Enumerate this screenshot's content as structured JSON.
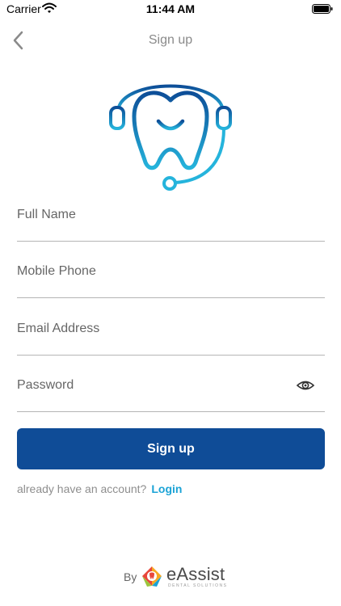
{
  "status_bar": {
    "carrier": "Carrier",
    "time": "11:44 AM"
  },
  "nav": {
    "title": "Sign up",
    "back_icon": "chevron-left-icon"
  },
  "logo": {
    "icon": "tooth-headset-icon",
    "gradient_start": "#0d4e98",
    "gradient_end": "#25b4dc"
  },
  "form": {
    "full_name": {
      "placeholder": "Full Name",
      "value": ""
    },
    "mobile_phone": {
      "placeholder": "Mobile Phone",
      "value": ""
    },
    "email": {
      "placeholder": "Email Address",
      "value": ""
    },
    "password": {
      "placeholder": "Password",
      "value": "",
      "toggle_icon": "eye-icon"
    }
  },
  "actions": {
    "signup_label": "Sign up",
    "signup_color": "#0f4c97",
    "account_prompt": "already have an account?",
    "login_label": "Login",
    "login_color": "#1ba3d6"
  },
  "footer": {
    "by": "By",
    "brand": "eAssist",
    "tagline": "DENTAL SOLUTIONS"
  }
}
